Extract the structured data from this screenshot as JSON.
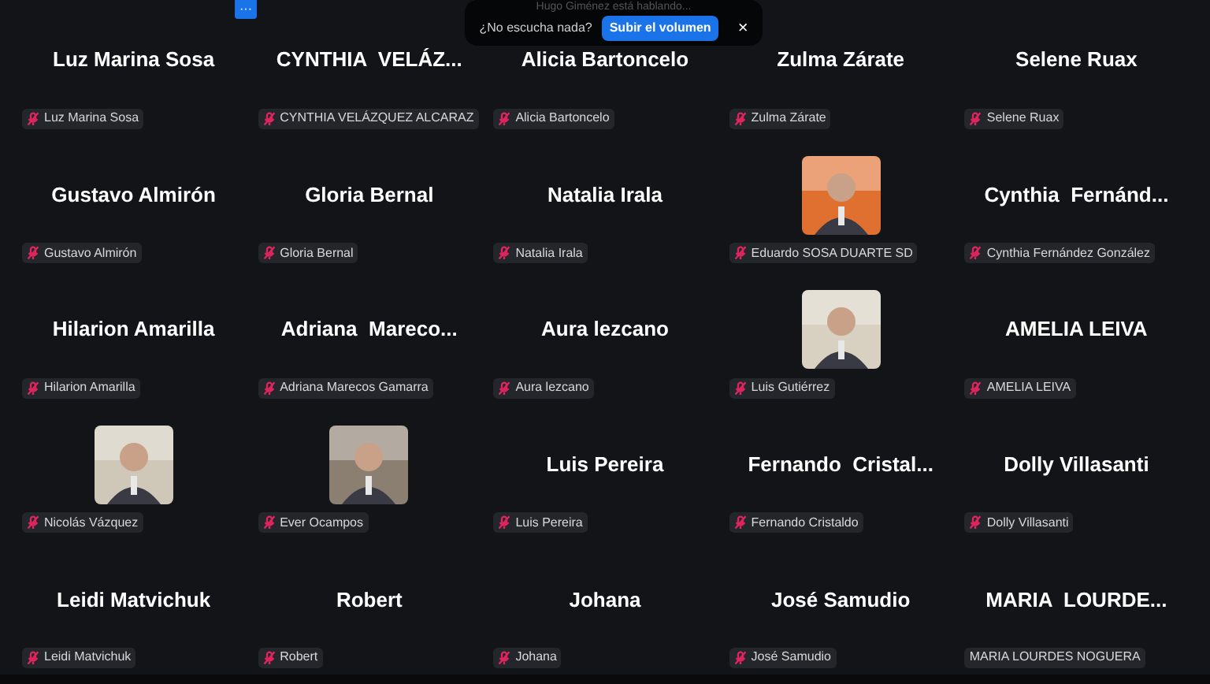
{
  "toast": {
    "speaking": "Hugo Giménez está hablando...",
    "message": "¿No escucha nada?",
    "button": "Subir el volumen",
    "close": "×"
  },
  "more_button": "···",
  "tiles": [
    {
      "kind": "name",
      "display": "Luz Marina Sosa",
      "label": "Luz Marina Sosa",
      "muted": true
    },
    {
      "kind": "name",
      "display": "CYNTHIA  VELÁZ...",
      "label": "CYNTHIA VELÁZQUEZ ALCARAZ",
      "muted": true
    },
    {
      "kind": "name",
      "display": "Alicia Bartoncelo",
      "label": "Alicia Bartoncelo",
      "muted": true
    },
    {
      "kind": "name",
      "display": "Zulma Zárate",
      "label": "Zulma Zárate",
      "muted": true
    },
    {
      "kind": "name",
      "display": "Selene Ruax",
      "label": "Selene Ruax",
      "muted": true
    },
    {
      "kind": "name",
      "display": "Gustavo Almirón",
      "label": "Gustavo Almirón",
      "muted": true
    },
    {
      "kind": "name",
      "display": "Gloria Bernal",
      "label": "Gloria Bernal",
      "muted": true
    },
    {
      "kind": "name",
      "display": "Natalia Irala",
      "label": "Natalia Irala",
      "muted": true
    },
    {
      "kind": "picture",
      "label": "Eduardo SOSA DUARTE SD",
      "muted": true
    },
    {
      "kind": "name",
      "display": "Cynthia  Fernánd...",
      "label": "Cynthia Fernández González",
      "muted": true
    },
    {
      "kind": "name",
      "display": "Hilarion Amarilla",
      "label": "Hilarion Amarilla",
      "muted": true
    },
    {
      "kind": "name",
      "display": "Adriana  Mareco...",
      "label": "Adriana Marecos Gamarra",
      "muted": true
    },
    {
      "kind": "name",
      "display": "Aura lezcano",
      "label": "Aura lezcano",
      "muted": true
    },
    {
      "kind": "picture",
      "label": "Luis Gutiérrez",
      "muted": true
    },
    {
      "kind": "name",
      "display": "AMELIA LEIVA",
      "label": "AMELIA LEIVA",
      "muted": true
    },
    {
      "kind": "picture",
      "label": "Nicolás Vázquez",
      "muted": true
    },
    {
      "kind": "picture",
      "label": "Ever Ocampos",
      "muted": true
    },
    {
      "kind": "name",
      "display": "Luis Pereira",
      "label": "Luis Pereira",
      "muted": true
    },
    {
      "kind": "name",
      "display": "Fernando  Cristal...",
      "label": "Fernando Cristaldo",
      "muted": true
    },
    {
      "kind": "name",
      "display": "Dolly Villasanti",
      "label": "Dolly Villasanti",
      "muted": true
    },
    {
      "kind": "name",
      "display": "Leidi Matvichuk",
      "label": "Leidi Matvichuk",
      "muted": true
    },
    {
      "kind": "name",
      "display": "Robert",
      "label": "Robert",
      "muted": true
    },
    {
      "kind": "name",
      "display": "Johana",
      "label": "Johana",
      "muted": true
    },
    {
      "kind": "name",
      "display": "José Samudio",
      "label": "José Samudio",
      "muted": true
    },
    {
      "kind": "name",
      "display": "MARIA  LOURDE...",
      "label": "MARIA LOURDES NOGUERA",
      "muted": false
    }
  ]
}
